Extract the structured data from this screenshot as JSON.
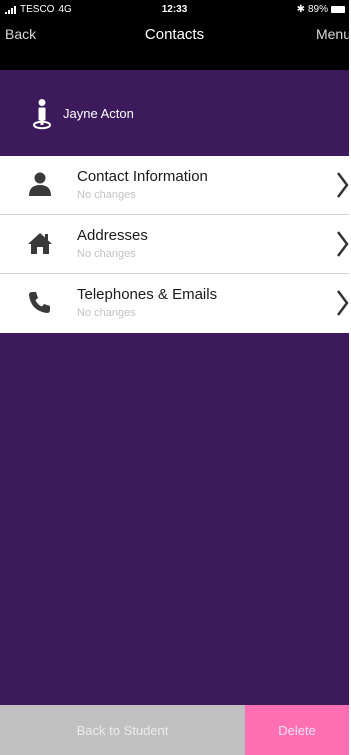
{
  "status_bar": {
    "carrier": "TESCO",
    "network": "4G",
    "time": "12:33",
    "bluetooth": "✱",
    "battery_percent": "89%",
    "battery_level": 0.89
  },
  "nav": {
    "back_label": "Back",
    "title": "Contacts",
    "menu_label": "Menu"
  },
  "person": {
    "name": "Jayne Acton",
    "icon": "person-pin-icon"
  },
  "menu_items": [
    {
      "title": "Contact Information",
      "subtitle": "No changes",
      "icon": "person-icon"
    },
    {
      "title": "Addresses",
      "subtitle": "No changes",
      "icon": "house-icon"
    },
    {
      "title": "Telephones & Emails",
      "subtitle": "No changes",
      "icon": "phone-icon"
    }
  ],
  "footer": {
    "back_to_student_label": "Back to Student",
    "delete_label": "Delete"
  },
  "colors": {
    "background_purple": "#3c1a5b",
    "nav_black": "#000000",
    "delete_pink": "#ff6fb4",
    "back_grey": "#c0c0c0"
  }
}
